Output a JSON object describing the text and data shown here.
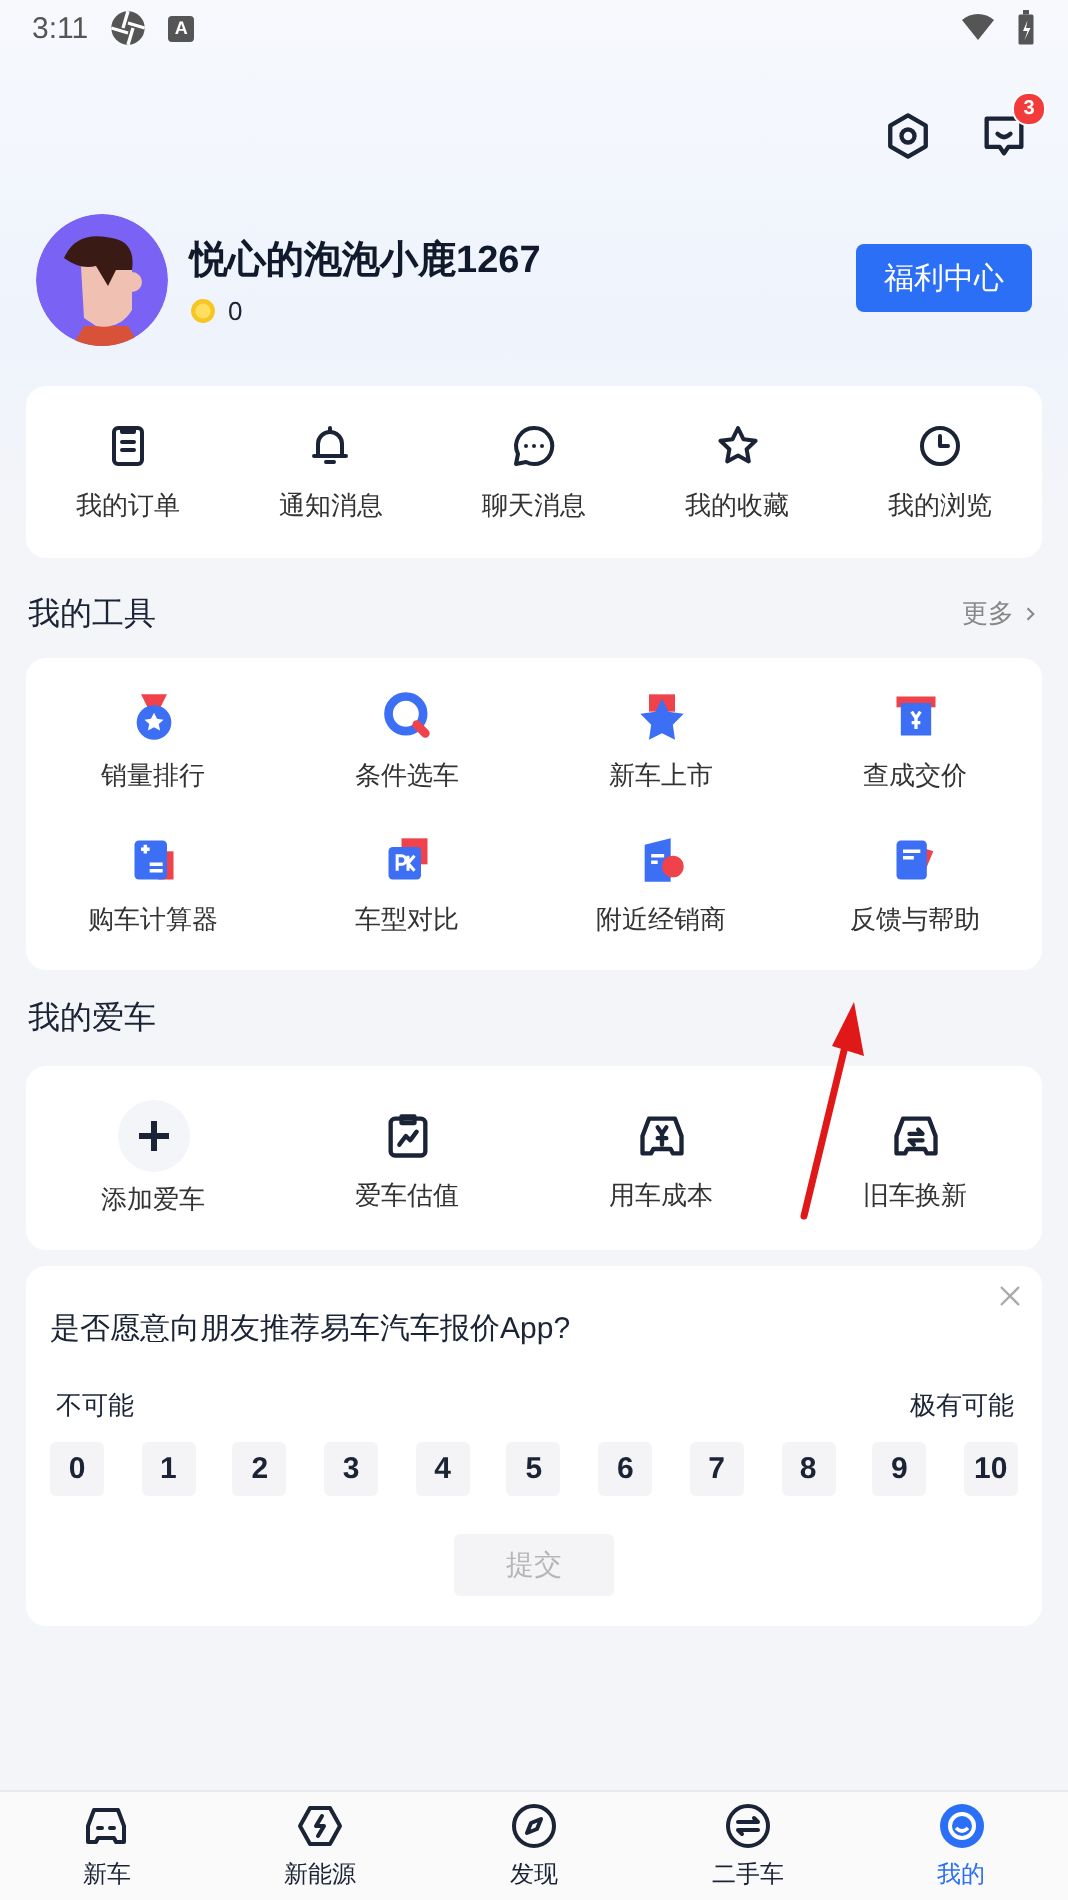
{
  "status_bar": {
    "time": "3:11",
    "indicator": "A"
  },
  "header": {
    "message_badge": "3"
  },
  "profile": {
    "name": "悦心的泡泡小鹿1267",
    "coins": "0",
    "button": "福利中心"
  },
  "shortcuts": [
    {
      "label": "我的订单"
    },
    {
      "label": "通知消息"
    },
    {
      "label": "聊天消息"
    },
    {
      "label": "我的收藏"
    },
    {
      "label": "我的浏览"
    }
  ],
  "tools": {
    "title": "我的工具",
    "more": "更多",
    "items": [
      {
        "label": "销量排行"
      },
      {
        "label": "条件选车"
      },
      {
        "label": "新车上市"
      },
      {
        "label": "查成交价"
      },
      {
        "label": "购车计算器"
      },
      {
        "label": "车型对比"
      },
      {
        "label": "附近经销商"
      },
      {
        "label": "反馈与帮助"
      }
    ]
  },
  "my_car": {
    "title": "我的爱车",
    "items": [
      {
        "label": "添加爱车"
      },
      {
        "label": "爱车估值"
      },
      {
        "label": "用车成本"
      },
      {
        "label": "旧车换新"
      }
    ]
  },
  "survey": {
    "question": "是否愿意向朋友推荐易车汽车报价App?",
    "low_label": "不可能",
    "high_label": "极有可能",
    "scores": [
      {
        "label": "0",
        "selected": false
      },
      {
        "label": "1",
        "selected": false
      },
      {
        "label": "2",
        "selected": false
      },
      {
        "label": "3",
        "selected": false
      },
      {
        "label": "4",
        "selected": false
      },
      {
        "label": "5",
        "selected": false
      },
      {
        "label": "6",
        "selected": false
      },
      {
        "label": "7",
        "selected": false
      },
      {
        "label": "8",
        "selected": false
      },
      {
        "label": "9",
        "selected": false
      },
      {
        "label": "10",
        "selected": false
      }
    ],
    "submit": {
      "label": "提交",
      "disabled": true
    }
  },
  "bottom_nav": [
    {
      "label": "新车",
      "selected": false
    },
    {
      "label": "新能源",
      "selected": false
    },
    {
      "label": "发现",
      "selected": false
    },
    {
      "label": "二手车",
      "selected": false
    },
    {
      "label": "我的",
      "selected": true
    }
  ]
}
